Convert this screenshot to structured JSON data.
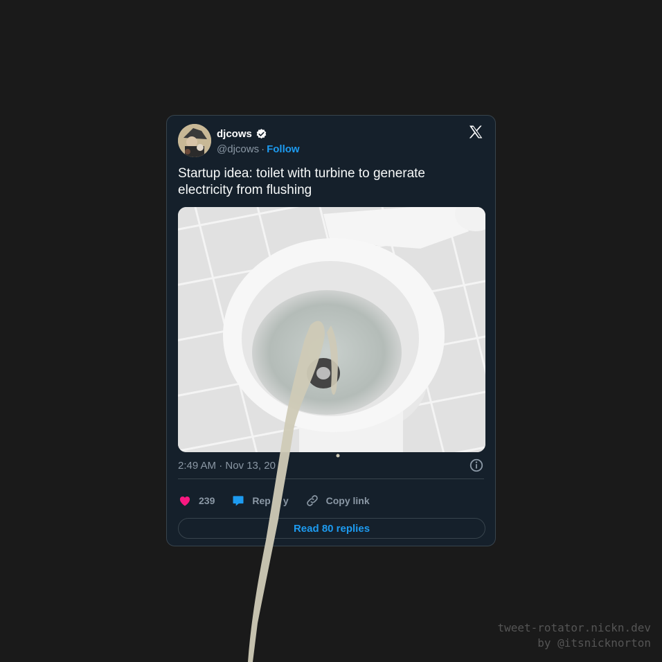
{
  "tweet": {
    "author": {
      "name": "djcows",
      "handle": "@djcows",
      "verified": true
    },
    "follow_label": "Follow",
    "separator": "·",
    "text": "Startup idea: toilet with turbine to generate electricity from flushing",
    "timestamp": "2:49 AM · Nov 13, 20",
    "likes": "239",
    "reply_label": "Rep",
    "reply_label_tail": "y",
    "copy_link_label": "Copy link",
    "read_replies_label": "Read 80 replies"
  },
  "icons": {
    "brand": "x-logo-icon",
    "verified": "verified-badge-icon",
    "like": "heart-icon",
    "reply": "speech-bubble-icon",
    "copy": "link-icon",
    "info": "info-icon"
  },
  "colors": {
    "background": "#1a1a1a",
    "card": "#15202b",
    "card_border": "#38444d",
    "accent": "#1d9bf0",
    "like": "#f91880",
    "muted": "#8b98a5",
    "text": "#f7f9f9"
  },
  "footer": {
    "line1": "tweet-rotator.nickn.dev",
    "line2": "by @itsnicknorton"
  }
}
